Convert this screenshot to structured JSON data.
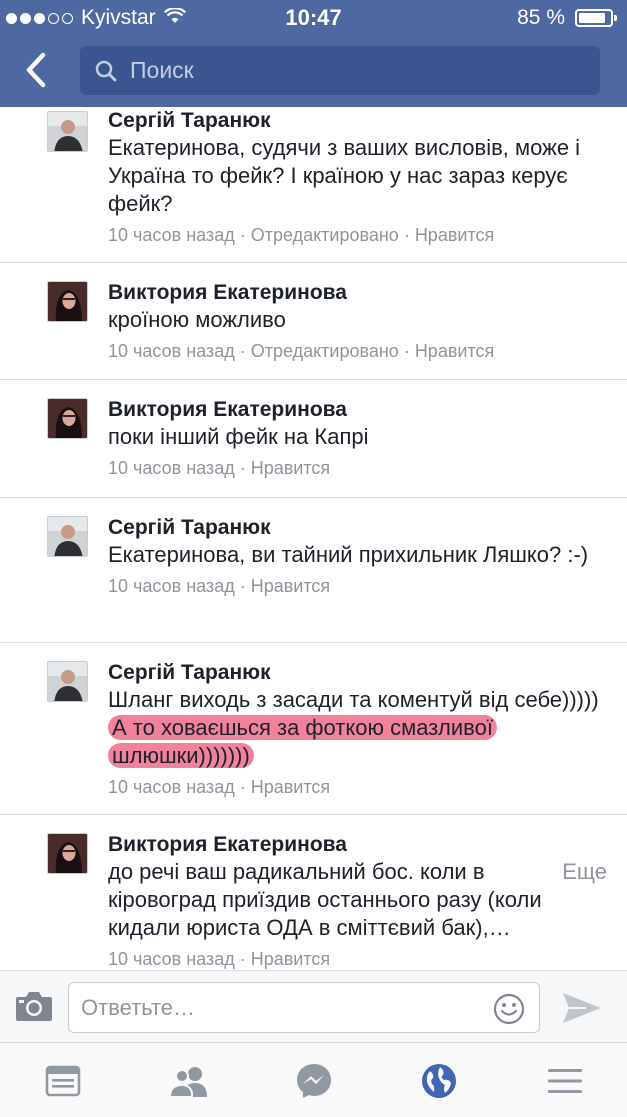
{
  "status_bar": {
    "carrier": "Kyivstar",
    "time": "10:47",
    "battery": "85 %"
  },
  "header": {
    "search_placeholder": "Поиск"
  },
  "comments": [
    {
      "author": "Сергій Таранюк",
      "text": "Екатеринова, судячи з ваших висловів, може і Україна то фейк? І країною у нас зараз керує фейк?",
      "time": "10 часов назад",
      "edited": "Отредактировано",
      "like": "Нравится"
    },
    {
      "author": "Виктория Екатеринова",
      "text": "кроїною можливо",
      "time": "10 часов назад",
      "edited": "Отредактировано",
      "like": "Нравится"
    },
    {
      "author": "Виктория Екатеринова",
      "text": "поки інший фейк на Капрі",
      "time": "10 часов назад",
      "like": "Нравится"
    },
    {
      "author": "Сергій Таранюк",
      "text": "Екатеринова, ви тайний прихильник Ляшко? :-)",
      "time": "10 часов назад",
      "like": "Нравится"
    },
    {
      "author": "Сергій Таранюк",
      "text": "Шланг виходь з засади та коментуй від себе)))))",
      "text_highlighted": "А то ховаєшься за фоткою смазливої шлюшки)))))))",
      "time": "10 часов назад",
      "like": "Нравится"
    },
    {
      "author": "Виктория Екатеринова",
      "text": "до речі ваш радикальний бос. коли в кіровоград приїздив останнього разу (коли кидали юриста ОДА в сміттєвий бак),…",
      "more": "Еще",
      "time": "10 часов назад",
      "like": "Нравится"
    }
  ],
  "meta_separator": " · ",
  "reply": {
    "placeholder": "Ответьте…"
  },
  "icons": {
    "back": "chevron-left-icon",
    "search": "search-icon",
    "camera": "camera-icon",
    "emoji": "smiley-icon",
    "send": "send-icon",
    "tabs": [
      "news-feed-icon",
      "friends-icon",
      "messenger-icon",
      "globe-icon",
      "menu-icon"
    ]
  },
  "colors": {
    "header_bg": "#4e69a2",
    "highlight": "#e83660",
    "active_tab": "#4267b2"
  }
}
